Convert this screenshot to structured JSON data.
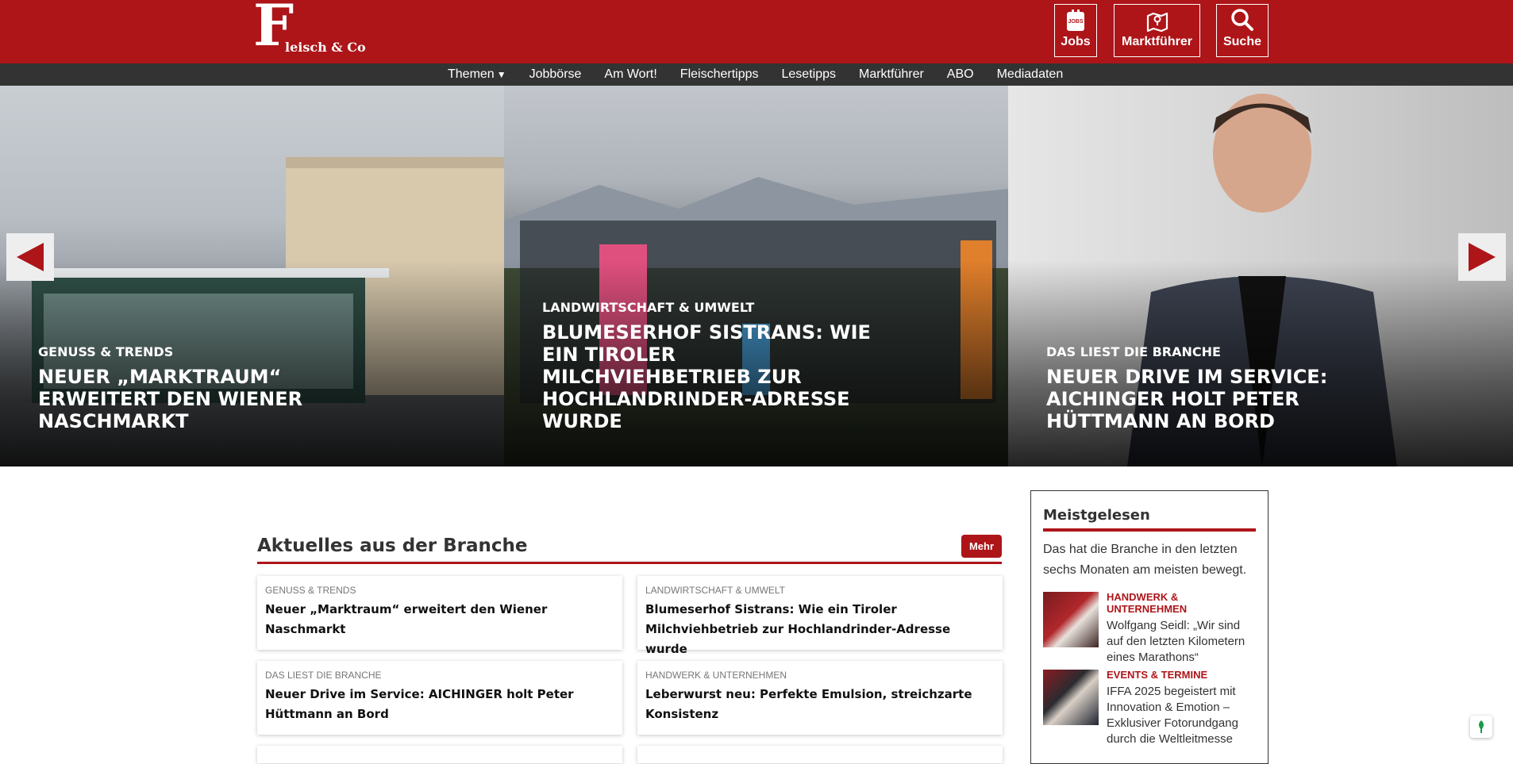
{
  "header": {
    "logo_big": "F",
    "logo_rest": "leisch & Co",
    "buttons": {
      "jobs": "Jobs",
      "jobs_badge": "JOBS",
      "market": "Marktführer",
      "search": "Suche"
    }
  },
  "nav": {
    "items": [
      "Themen",
      "Jobbörse",
      "Am Wort!",
      "Fleischertipps",
      "Lesetipps",
      "Marktführer",
      "ABO",
      "Mediadaten"
    ],
    "caret": "▼"
  },
  "hero": {
    "slides": [
      {
        "category": "Genuss & Trends",
        "title": "Neuer „Marktraum“ erweitert den Wiener Naschmarkt"
      },
      {
        "category": "Landwirtschaft & Umwelt",
        "title": "Blumeserhof Sistrans: Wie ein Tiroler Milchviehbetrieb zur Hochlandrinder-Adresse wurde"
      },
      {
        "category": "Das liest die Branche",
        "title": "Neuer Drive im Service: AICHINGER holt Peter Hüttmann an Bord"
      }
    ]
  },
  "main": {
    "section_title": "Aktuelles aus der Branche",
    "more_label": "Mehr",
    "cards": [
      {
        "category": "Genuss & Trends",
        "title": "Neuer „Marktraum“ erweitert den Wiener Naschmarkt"
      },
      {
        "category": "Landwirtschaft & Umwelt",
        "title": "Blumeserhof Sistrans: Wie ein Tiroler Milchviehbetrieb zur Hochlandrinder-Adresse wurde"
      },
      {
        "category": "Das liest die Branche",
        "title": "Neuer Drive im Service: AICHINGER holt Peter Hüttmann an Bord"
      },
      {
        "category": "Handwerk & Unternehmen",
        "title": "Leberwurst neu: Perfekte Emulsion, streichzarte Konsistenz"
      }
    ]
  },
  "sidebar": {
    "title": "Meistgelesen",
    "description": "Das hat die Branche in den letzten sechs Monaten am meisten bewegt.",
    "items": [
      {
        "category": "Handwerk & Unternehmen",
        "title": "Wolfgang Seidl: „Wir sind auf den letzten Kilometern eines Marathons“"
      },
      {
        "category": "Events & Termine",
        "title": "IFFA 2025 begeistert mit Innovation & Emotion – Exklusiver Fotorundgang durch die Weltleitmesse"
      }
    ]
  },
  "colors": {
    "brand_red": "#ad1519",
    "nav_dark": "#333333"
  }
}
